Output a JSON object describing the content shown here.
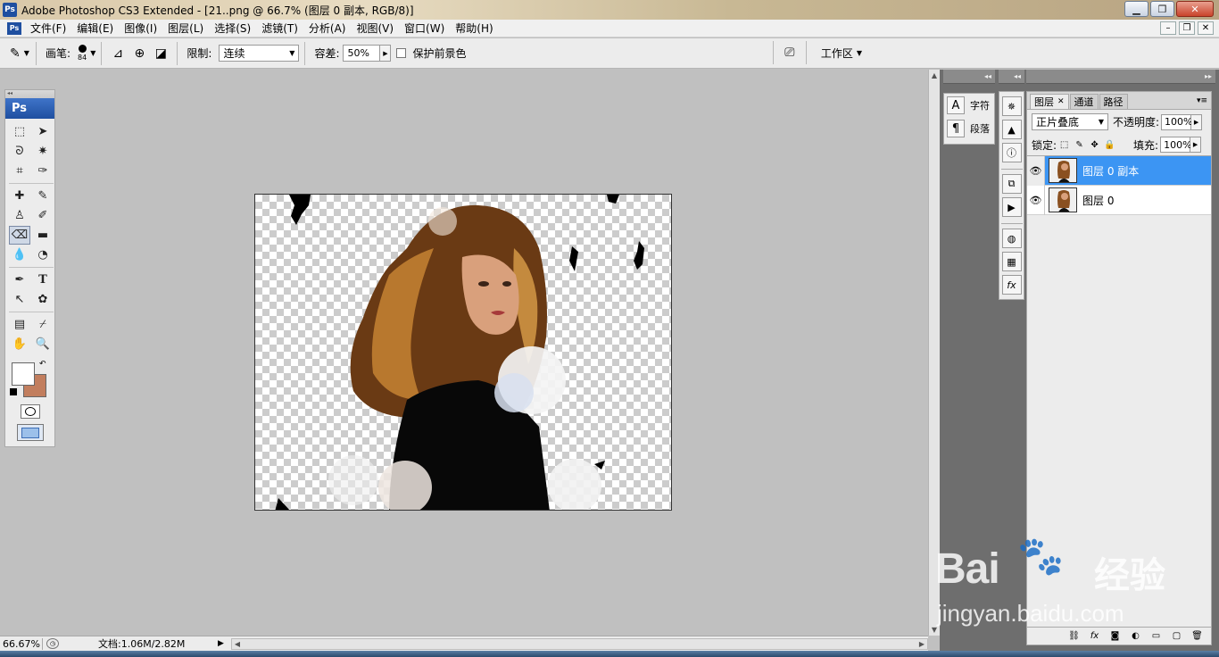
{
  "window": {
    "title": "Adobe Photoshop CS3 Extended - [21..png @ 66.7% (图层 0 副本, RGB/8)]",
    "app_icon": "Ps",
    "controls": [
      "minimize-icon",
      "maximize-icon",
      "close-icon"
    ]
  },
  "menubar": {
    "items": [
      "文件(F)",
      "编辑(E)",
      "图像(I)",
      "图层(L)",
      "选择(S)",
      "滤镜(T)",
      "分析(A)",
      "视图(V)",
      "窗口(W)",
      "帮助(H)"
    ]
  },
  "options": {
    "brush_label": "画笔:",
    "brush_size": "84",
    "limit_label": "限制:",
    "limit_value": "连续",
    "tolerance_label": "容差:",
    "tolerance_value": "50%",
    "protect_fg_label": "保护前景色",
    "protect_fg_checked": false,
    "workspace_label": "工作区"
  },
  "toolbox": {
    "header": "Ps",
    "active_tool": "background-eraser-tool",
    "foreground_color": "#ffffff",
    "background_color": "#c27e5e"
  },
  "statusbar": {
    "zoom": "66.67%",
    "doc_info": "文档:1.06M/2.82M"
  },
  "dock": {
    "character_label": "字符",
    "paragraph_label": "段落"
  },
  "layers_panel": {
    "tabs": [
      "图层",
      "通道",
      "路径"
    ],
    "active_tab": "图层",
    "blend_mode": "正片叠底",
    "opacity_label": "不透明度:",
    "opacity_value": "100%",
    "lock_label": "锁定:",
    "fill_label": "填充:",
    "fill_value": "100%",
    "layers": [
      {
        "name": "图层 0 副本",
        "selected": true,
        "visible": true
      },
      {
        "name": "图层 0",
        "selected": false,
        "visible": true
      }
    ],
    "accent_color": "#3c95f3"
  },
  "watermark": {
    "logo_text": "Bai",
    "logo_text2": "经验",
    "url": "jingyan.baidu.com"
  }
}
